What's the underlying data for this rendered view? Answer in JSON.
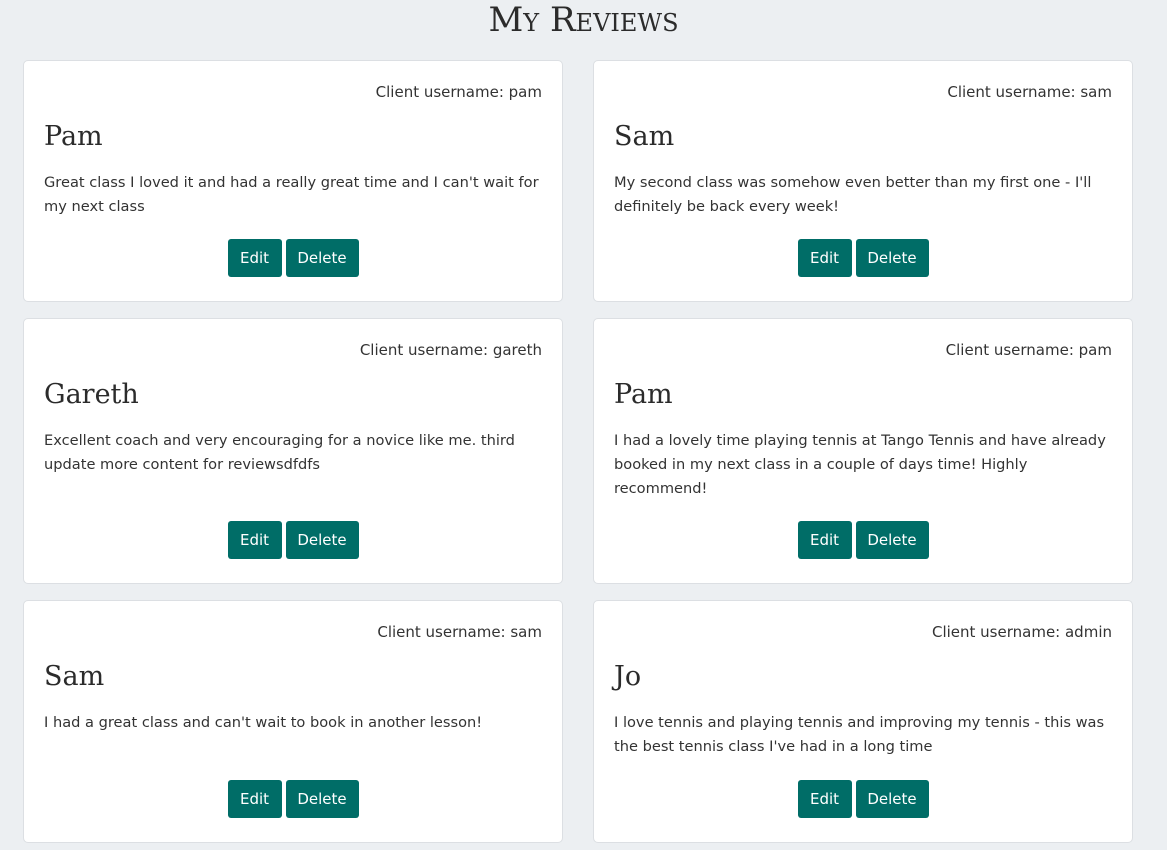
{
  "page": {
    "title": "My Reviews"
  },
  "labels": {
    "edit": "Edit",
    "delete": "Delete"
  },
  "reviews": [
    {
      "username": "Client username: pam",
      "name": "Pam",
      "text": "Great class I loved it and had a really great time and I can't wait for my next class"
    },
    {
      "username": "Client username: sam",
      "name": "Sam",
      "text": "My second class was somehow even better than my first one - I'll definitely be back every week!"
    },
    {
      "username": "Client username: gareth",
      "name": "Gareth",
      "text": "Excellent coach and very encouraging for a novice like me. third update more content for reviewsdfdfs"
    },
    {
      "username": "Client username: pam",
      "name": "Pam",
      "text": "I had a lovely time playing tennis at Tango Tennis and have already booked in my next class in a couple of days time! Highly recommend!"
    },
    {
      "username": "Client username: sam",
      "name": "Sam",
      "text": "I had a great class and can't wait to book in another lesson!"
    },
    {
      "username": "Client username: admin",
      "name": "Jo",
      "text": "I love tennis and playing tennis and improving my tennis - this was the best tennis class I've had in a long time"
    }
  ],
  "colors": {
    "button": "#006d67",
    "background": "#eceff2",
    "card": "#ffffff"
  }
}
